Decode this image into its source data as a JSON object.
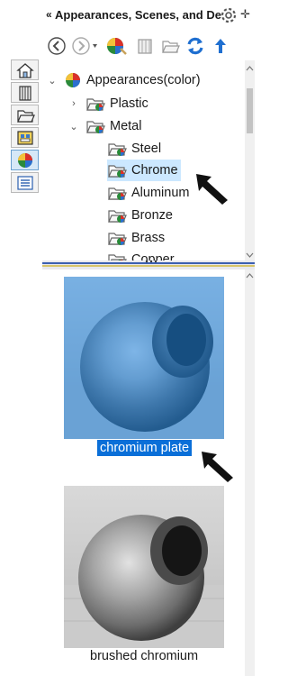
{
  "header": {
    "title": "Appearances, Scenes, and De"
  },
  "tree": {
    "root": "Appearances(color)",
    "items": [
      {
        "label": "Plastic"
      },
      {
        "label": "Metal"
      },
      {
        "label": "Steel"
      },
      {
        "label": "Chrome"
      },
      {
        "label": "Aluminum"
      },
      {
        "label": "Bronze"
      },
      {
        "label": "Brass"
      },
      {
        "label": "Copper"
      }
    ]
  },
  "gallery": {
    "items": [
      {
        "label": "chromium plate"
      },
      {
        "label": "brushed chromium"
      }
    ]
  },
  "colors": {
    "selection_bg": "#cce8ff",
    "selected_label": "#0a6fd8",
    "highlight_overlay": "#1e7fd8"
  },
  "icons": [
    "home-icon",
    "3d-content-icon",
    "open-folder-icon",
    "toolbox-icon",
    "appearances-icon",
    "properties-icon",
    "back-icon",
    "forward-icon",
    "appearance-ball-icon",
    "decals-icon",
    "scene-icon",
    "refresh-icon",
    "up-icon",
    "gear-icon",
    "pin-icon"
  ]
}
